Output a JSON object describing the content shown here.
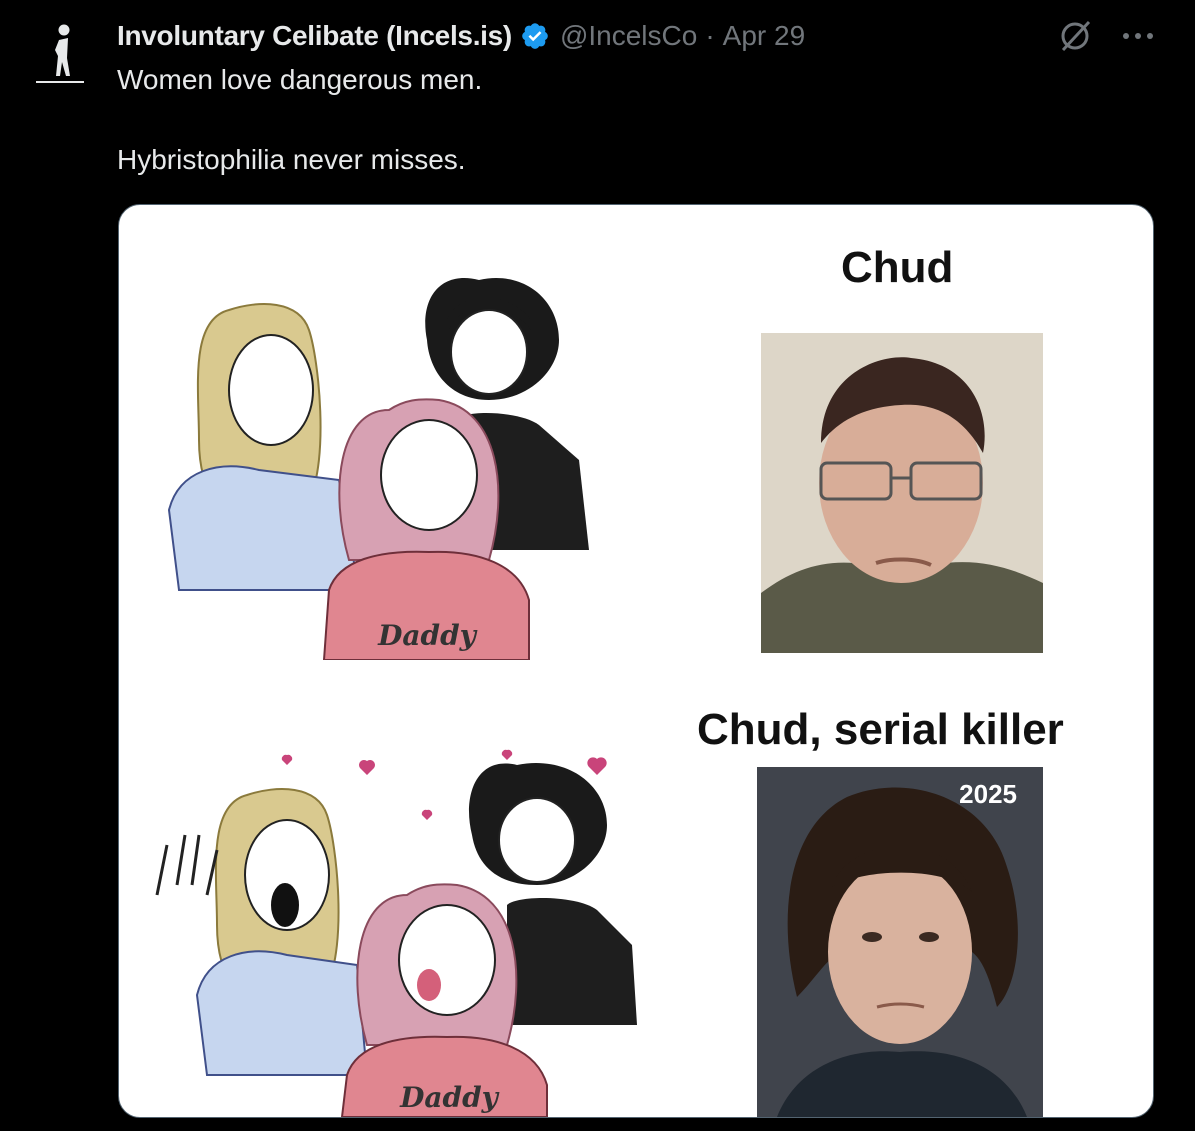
{
  "tweet": {
    "author_name": "Involuntary Celibate (Incels.is)",
    "handle": "@IncelsCo",
    "separator": "·",
    "date": "Apr 29",
    "text_line1": "Women love dangerous men.",
    "text_line2": "Hybristophilia never misses."
  },
  "meme": {
    "top_caption": "Chud",
    "bottom_caption": "Chud, serial killer",
    "shirt_text_top": "Daddy",
    "shirt_text_bottom": "Daddy",
    "photo_year": "2025"
  },
  "colors": {
    "verified_badge": "#1d9bf0",
    "background": "#000000",
    "muted_text": "#71767b"
  },
  "icons": {
    "avatar": "stick-figure-logo",
    "verified": "verified-badge-icon",
    "grok": "grok-icon",
    "more": "more-options-icon"
  }
}
